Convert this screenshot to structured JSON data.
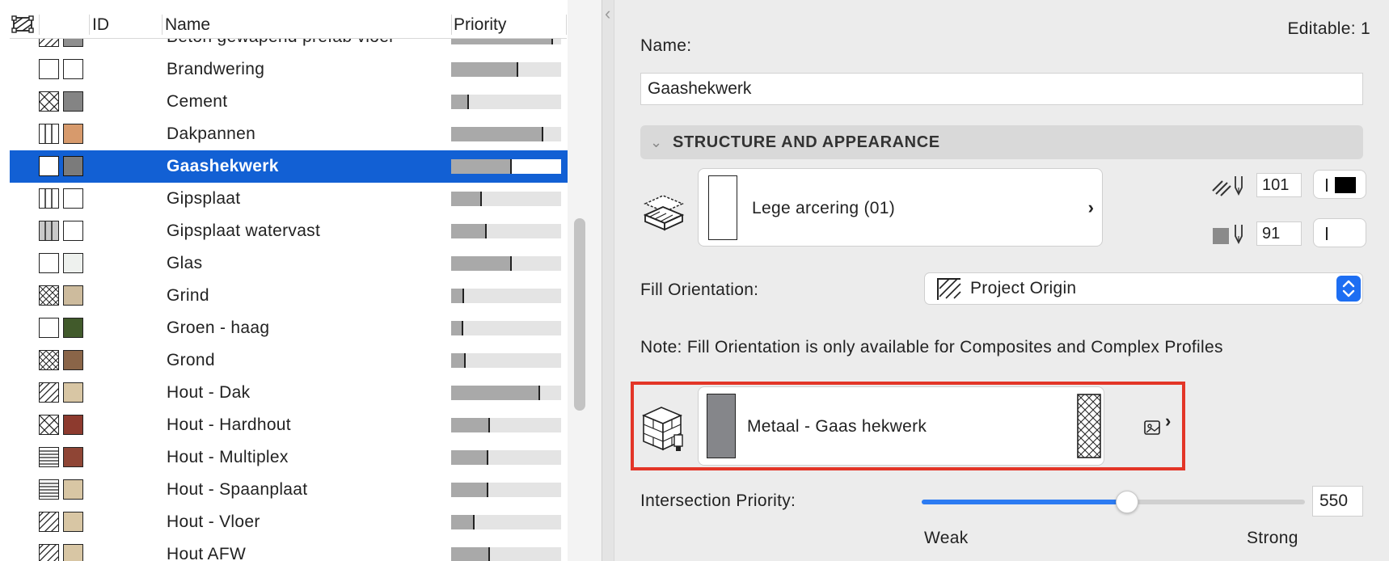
{
  "list": {
    "columns": {
      "id": "ID",
      "name": "Name",
      "priority": "Priority"
    },
    "rows": [
      {
        "name": "Beton gewapend prefab vloer",
        "fill": "#8f8f8f",
        "pattern": "diag",
        "priority": 0.93,
        "selected": false
      },
      {
        "name": "Brandwering",
        "fill": "#ffffff",
        "pattern": "empty",
        "priority": 0.61,
        "selected": false
      },
      {
        "name": "Cement",
        "fill": "#848484",
        "pattern": "cross",
        "priority": 0.16,
        "selected": false
      },
      {
        "name": "Dakpannen",
        "fill": "#d79a6c",
        "pattern": "vlines",
        "priority": 0.84,
        "selected": false
      },
      {
        "name": "Gaashekwerk",
        "fill": "#7b7b7b",
        "pattern": "empty",
        "priority": 0.55,
        "selected": true
      },
      {
        "name": "Gipsplaat",
        "fill": "#ffffff",
        "pattern": "vlines",
        "priority": 0.28,
        "selected": false
      },
      {
        "name": "Gipsplaat watervast",
        "fill": "#ffffff",
        "pattern": "vlinesgray",
        "priority": 0.32,
        "selected": false
      },
      {
        "name": "Glas",
        "fill": "#eef1ee",
        "pattern": "empty",
        "priority": 0.55,
        "selected": false
      },
      {
        "name": "Grind",
        "fill": "#cdbb9d",
        "pattern": "dots",
        "priority": 0.12,
        "selected": false
      },
      {
        "name": "Groen - haag",
        "fill": "#415a2b",
        "pattern": "empty",
        "priority": 0.11,
        "selected": false
      },
      {
        "name": "Grond",
        "fill": "#8a6548",
        "pattern": "dots",
        "priority": 0.13,
        "selected": false
      },
      {
        "name": "Hout - Dak",
        "fill": "#d8c6a4",
        "pattern": "diag",
        "priority": 0.81,
        "selected": false
      },
      {
        "name": "Hout - Hardhout",
        "fill": "#8d3a2e",
        "pattern": "cross",
        "priority": 0.35,
        "selected": false
      },
      {
        "name": "Hout - Multiplex",
        "fill": "#8f4535",
        "pattern": "hlines",
        "priority": 0.34,
        "selected": false
      },
      {
        "name": "Hout - Spaanplaat",
        "fill": "#d8c6a4",
        "pattern": "hlines",
        "priority": 0.34,
        "selected": false
      },
      {
        "name": "Hout - Vloer",
        "fill": "#d8c6a4",
        "pattern": "diag",
        "priority": 0.21,
        "selected": false
      },
      {
        "name": "Hout AFW",
        "fill": "#d8c6a4",
        "pattern": "diag",
        "priority": 0.35,
        "selected": false
      }
    ]
  },
  "panel": {
    "editable": "Editable: 1",
    "name_label": "Name:",
    "name_value": "Gaashekwerk",
    "section_title": "STRUCTURE AND APPEARANCE",
    "cut_fill": {
      "label": "Lege arcering (01)",
      "foreground_pen": "101",
      "background_pen": "91"
    },
    "fill_orientation": {
      "label": "Fill Orientation:",
      "value": "Project Origin"
    },
    "note": "Note: Fill Orientation is only available for Composites and Complex Profiles",
    "surface": {
      "label": "Metaal - Gaas hekwerk",
      "swatch_color": "#85868a"
    },
    "intersection": {
      "label": "Intersection Priority:",
      "value": "550",
      "level": 0.55,
      "weak_label": "Weak",
      "strong_label": "Strong"
    }
  },
  "colors": {
    "selection": "#1260d4",
    "accent": "#1d6ef2",
    "highlight": "#e33527"
  }
}
